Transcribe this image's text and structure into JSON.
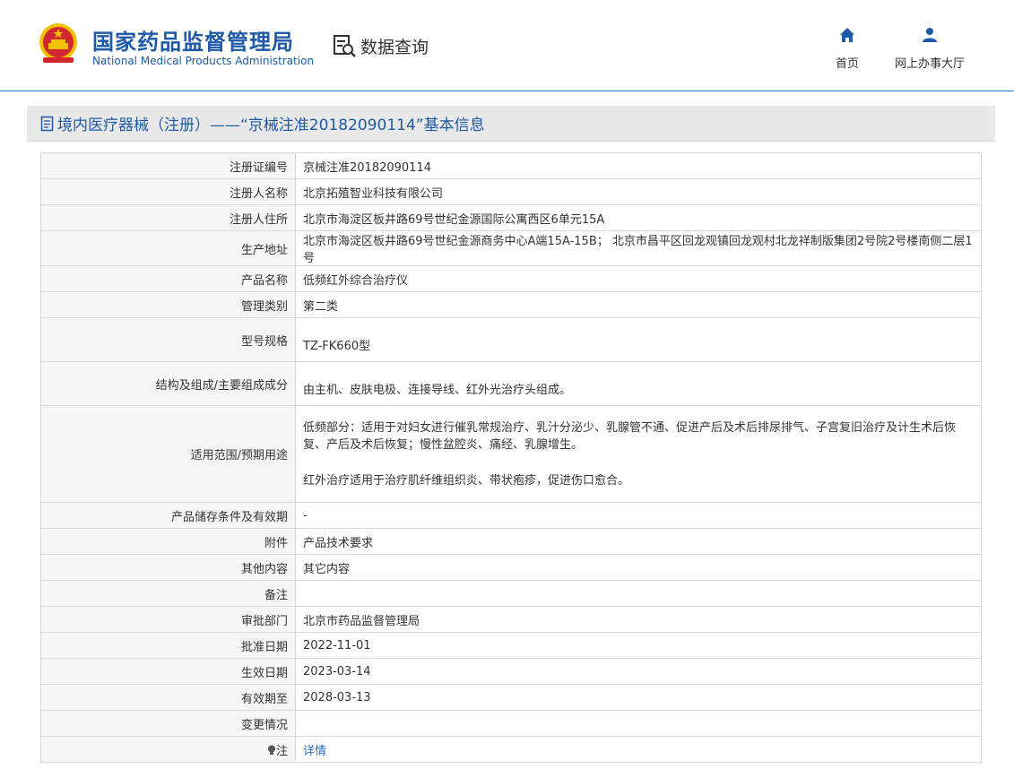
{
  "header": {
    "org_name_cn": "国家药品监督管理局",
    "org_name_en": "National Medical Products Administration",
    "page_name": "数据查询",
    "nav": [
      {
        "label": "首页",
        "icon": "home-icon"
      },
      {
        "label": "网上办事大厅",
        "icon": "user-icon"
      }
    ]
  },
  "panel": {
    "title": "境内医疗器械（注册）——“京械注准20182090114”基本信息"
  },
  "record": {
    "rows": [
      {
        "key": "注册证编号",
        "value": "京械注准20182090114"
      },
      {
        "key": "注册人名称",
        "value": "北京拓殖智业科技有限公司"
      },
      {
        "key": "注册人住所",
        "value": "北京市海淀区板井路69号世纪金源国际公寓西区6单元15A"
      },
      {
        "key": "生产地址",
        "value": "北京市海淀区板井路69号世纪金源商务中心A端15A-15B； 北京市昌平区回龙观镇回龙观村北龙祥制版集团2号院2号楼南侧二层1号"
      },
      {
        "key": "产品名称",
        "value": "低频红外综合治疗仪"
      },
      {
        "key": "管理类别",
        "value": "第二类"
      },
      {
        "key": "型号规格",
        "value": "TZ-FK660型"
      },
      {
        "key": "结构及组成/主要组成成分",
        "value": "由主机、皮肤电极、连接导线、红外光治疗头组成。"
      },
      {
        "key": "适用范围/预期用途",
        "value_p1": "低频部分：适用于对妇女进行催乳常规治疗、乳汁分泌少、乳腺管不通、促进产后及术后排尿排气、子宫复旧治疗及计生术后恢复、产后及术后恢复；慢性盆腔炎、痛经、乳腺增生。",
        "value_p2": "红外治疗适用于治疗肌纤维组织炎、带状疱疹，促进伤口愈合。"
      },
      {
        "key": "产品储存条件及有效期",
        "value": "-"
      },
      {
        "key": "附件",
        "value": "产品技术要求"
      },
      {
        "key": "其他内容",
        "value": "其它内容"
      },
      {
        "key": "备注",
        "value": ""
      },
      {
        "key": "审批部门",
        "value": "北京市药品监督管理局"
      },
      {
        "key": "批准日期",
        "value": "2022-11-01"
      },
      {
        "key": "生效日期",
        "value": "2023-03-14"
      },
      {
        "key": "有效期至",
        "value": "2028-03-13"
      },
      {
        "key": "变更情况",
        "value": ""
      },
      {
        "key": "注",
        "value": "详情"
      }
    ]
  },
  "colors": {
    "brand_blue": "#1e5aa8",
    "link_blue": "#2a6fbd",
    "emblem_red": "#d0282e",
    "emblem_gold": "#f2c100"
  }
}
